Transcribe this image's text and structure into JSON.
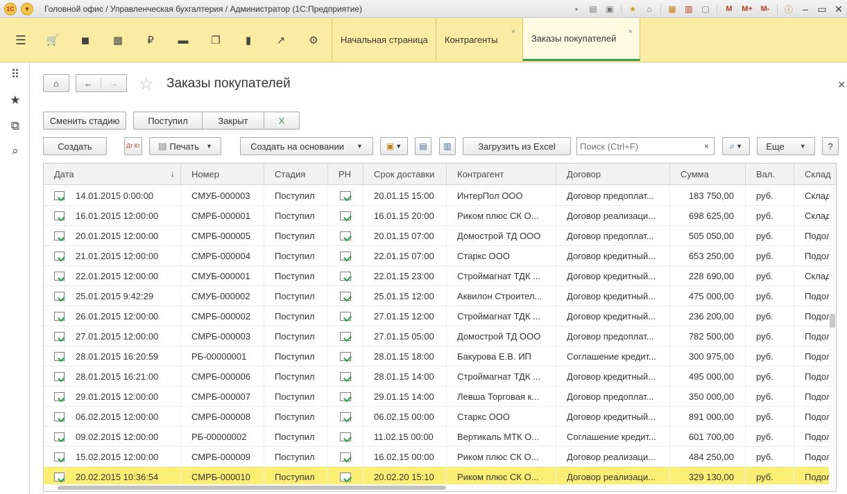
{
  "window": {
    "title": "Головной офис / Управленческая бухгалтерия / Администратор  (1С:Предприятие)",
    "logo": "1С"
  },
  "sections": [
    "cart-icon",
    "bag-icon",
    "grid-icon",
    "ruble-icon",
    "truck-icon",
    "docs-icon",
    "bar-chart-icon",
    "trend-icon",
    "gear-icon"
  ],
  "tabs": [
    {
      "label": "Начальная страница"
    },
    {
      "label": "Контрагенты",
      "close": "×"
    },
    {
      "label": "Заказы покупателей",
      "close": "×",
      "active": true
    }
  ],
  "page": {
    "title": "Заказы покупателей"
  },
  "stage_buttons": {
    "change": "Сменить стадию",
    "received": "Поступил",
    "closed": "Закрыт",
    "x": "X"
  },
  "toolbar": {
    "create": "Создать",
    "print": "Печать",
    "create_based": "Создать на основании",
    "load_excel": "Загрузить из Excel",
    "more": "Еще",
    "help": "?",
    "dtkt": "Дт Кт"
  },
  "search": {
    "placeholder": "Поиск (Ctrl+F)",
    "value": "",
    "clear": "×"
  },
  "table": {
    "columns": [
      "Дата",
      "Номер",
      "Стадия",
      "РН",
      "Срок доставки",
      "Контрагент",
      "Договор",
      "Сумма",
      "Вал.",
      "Склад"
    ],
    "sort_indicator": "↓",
    "rows": [
      {
        "date": "14.01.2015 0:00:00",
        "num": "СМУБ-000003",
        "stage": "Поступил",
        "deliv": "20.01.15 15:00",
        "agent": "ИнтерПол ООО",
        "contract": "Договор предоплат...",
        "sum": "183 750,00",
        "cur": "руб.",
        "wh": "Склад к"
      },
      {
        "date": "16.01.2015 12:00:00",
        "num": "СМРБ-000001",
        "stage": "Поступил",
        "deliv": "16.01.15 20:00",
        "agent": "Риком плюс СК О...",
        "contract": "Договор реализаци...",
        "sum": "698 625,00",
        "cur": "руб.",
        "wh": "Склад к"
      },
      {
        "date": "20.01.2015 12:00:00",
        "num": "СМРБ-000005",
        "stage": "Поступил",
        "deliv": "20.01.15 07:00",
        "agent": "Домострой ТД ООО",
        "contract": "Договор предоплат...",
        "sum": "505 050,00",
        "cur": "руб.",
        "wh": "Подольс"
      },
      {
        "date": "21.01.2015 12:00:00",
        "num": "СМРБ-000004",
        "stage": "Поступил",
        "deliv": "22.01.15 07:00",
        "agent": "Старкс ООО",
        "contract": "Договор кредитный...",
        "sum": "653 250,00",
        "cur": "руб.",
        "wh": "Подольс"
      },
      {
        "date": "22.01.2015 12:00:00",
        "num": "СМУБ-000001",
        "stage": "Поступил",
        "deliv": "22.01.15 23:00",
        "agent": "Строймагнат ТДК ...",
        "contract": "Договор кредитный...",
        "sum": "228 690,00",
        "cur": "руб.",
        "wh": "Склад к"
      },
      {
        "date": "25.01.2015 9:42:29",
        "num": "СМУБ-000002",
        "stage": "Поступил",
        "deliv": "25.01.15 12:00",
        "agent": "Аквилон Строител...",
        "contract": "Договор кредитный...",
        "sum": "475 000,00",
        "cur": "руб.",
        "wh": "Подольс"
      },
      {
        "date": "26.01.2015 12:00:00",
        "num": "СМРБ-000002",
        "stage": "Поступил",
        "deliv": "27.01.15 12:00",
        "agent": "Строймагнат ТДК ...",
        "contract": "Договор кредитный...",
        "sum": "236 200,00",
        "cur": "руб.",
        "wh": "Подольс"
      },
      {
        "date": "27.01.2015 12:00:00",
        "num": "СМРБ-000003",
        "stage": "Поступил",
        "deliv": "27.01.15 05:00",
        "agent": "Домострой ТД ООО",
        "contract": "Договор предоплат...",
        "sum": "782 500,00",
        "cur": "руб.",
        "wh": "Подольс"
      },
      {
        "date": "28.01.2015 16:20:59",
        "num": "РБ-00000001",
        "stage": "Поступил",
        "deliv": "28.01.15 18:00",
        "agent": "Бакурова Е.В. ИП",
        "contract": "Соглашение кредит...",
        "sum": "300 975,00",
        "cur": "руб.",
        "wh": "Подольс"
      },
      {
        "date": "28.01.2015 16:21:00",
        "num": "СМРБ-000006",
        "stage": "Поступил",
        "deliv": "28.01.15 14:00",
        "agent": "Строймагнат ТДК ...",
        "contract": "Договор кредитный...",
        "sum": "495 000,00",
        "cur": "руб.",
        "wh": "Подольс"
      },
      {
        "date": "29.01.2015 12:00:00",
        "num": "СМРБ-000007",
        "stage": "Поступил",
        "deliv": "29.01.15 14:00",
        "agent": "Левша Торговая к...",
        "contract": "Договор предоплат...",
        "sum": "350 000,00",
        "cur": "руб.",
        "wh": "Подольс"
      },
      {
        "date": "06.02.2015 12:00:00",
        "num": "СМРБ-000008",
        "stage": "Поступил",
        "deliv": "06.02.15 00:00",
        "agent": "Старкс ООО",
        "contract": "Договор кредитный...",
        "sum": "891 000,00",
        "cur": "руб.",
        "wh": "Подольс"
      },
      {
        "date": "09.02.2015 12:00:00",
        "num": "РБ-00000002",
        "stage": "Поступил",
        "deliv": "11.02.15 00:00",
        "agent": "Вертикаль МТК О...",
        "contract": "Соглашение кредит...",
        "sum": "601 700,00",
        "cur": "руб.",
        "wh": "Подольс"
      },
      {
        "date": "15.02.2015 12:00:00",
        "num": "СМРБ-000009",
        "stage": "Поступил",
        "deliv": "16.02.15 00:00",
        "agent": "Риком плюс СК О...",
        "contract": "Договор реализаци...",
        "sum": "484 250,00",
        "cur": "руб.",
        "wh": "Подольс"
      },
      {
        "date": "20.02.2015 10:36:54",
        "num": "СМРБ-000010",
        "stage": "Поступил",
        "deliv": "20.02.20 15:10",
        "agent": "Риком плюс СК О...",
        "contract": "Договор реализаци...",
        "sum": "329 130,00",
        "cur": "руб.",
        "wh": "Подольс",
        "selected": true
      }
    ]
  },
  "colors": {
    "section_bar": "#fbeca3",
    "active_tab_line": "#3d9b51",
    "selected_row": "#fbef73",
    "check": "#23a23d"
  }
}
